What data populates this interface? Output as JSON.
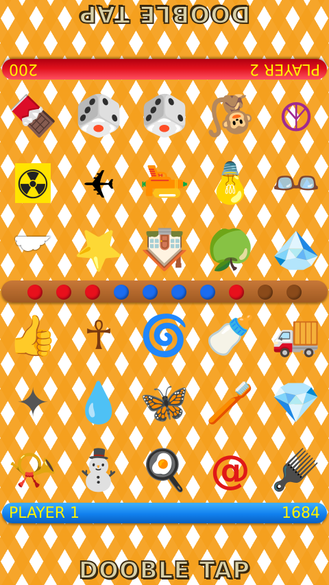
{
  "title": "DOOBLE TAP",
  "player2": {
    "label": "PLAYER 2",
    "score": "200"
  },
  "player1": {
    "label": "PLAYER 1",
    "score": "1684"
  },
  "colors": {
    "player1": "#1180ee",
    "player2": "#e0101c",
    "text": "#fff200",
    "track": "#a05a22"
  },
  "player2_board": [
    [
      "ice-cream-bar",
      "red-die",
      "green-die",
      "monkey",
      "peace-sign"
    ],
    [
      "radiation-sign",
      "airplane",
      "pistol",
      "light-bulb",
      "eyeglasses"
    ],
    [
      "cloud",
      "star",
      "house",
      "green-apple",
      "emerald"
    ]
  ],
  "player1_board": [
    [
      "thumbs-up-hand",
      "ankh",
      "spinning-top",
      "baby-bottle",
      "green-truck"
    ],
    [
      "metal-star",
      "water-drop",
      "butterfly",
      "toothbrush",
      "emerald"
    ],
    [
      "whistle",
      "snowman",
      "fried-egg",
      "at-sign",
      "comb"
    ]
  ],
  "progress": [
    {
      "state": "red",
      "color": "#e8101c"
    },
    {
      "state": "red",
      "color": "#e8101c"
    },
    {
      "state": "red",
      "color": "#e8101c"
    },
    {
      "state": "blue",
      "color": "#1a6cf0"
    },
    {
      "state": "blue",
      "color": "#1a6cf0"
    },
    {
      "state": "blue",
      "color": "#1a6cf0"
    },
    {
      "state": "blue",
      "color": "#1a6cf0"
    },
    {
      "state": "red",
      "color": "#e8101c"
    },
    {
      "state": "empty",
      "color": "#8a4a1a"
    },
    {
      "state": "empty",
      "color": "#8a4a1a"
    }
  ],
  "glyphs": {
    "ice-cream-bar": "🍫",
    "red-die": "🎲",
    "green-die": "🎲",
    "monkey": "🐒",
    "peace-sign": "☮",
    "radiation-sign": "☢",
    "airplane": "✈",
    "pistol": "🔫",
    "light-bulb": "💡",
    "eyeglasses": "👓",
    "cloud": "☁",
    "star": "⭐",
    "house": "🏠",
    "green-apple": "🍏",
    "emerald": "💎",
    "thumbs-up-hand": "👍",
    "ankh": "☥",
    "spinning-top": "🌀",
    "baby-bottle": "🍼",
    "green-truck": "🚚",
    "metal-star": "✦",
    "water-drop": "💧",
    "butterfly": "🦋",
    "toothbrush": "🪥",
    "whistle": "📯",
    "snowman": "⛄",
    "fried-egg": "🍳",
    "at-sign": "@",
    "comb": "🪮"
  }
}
